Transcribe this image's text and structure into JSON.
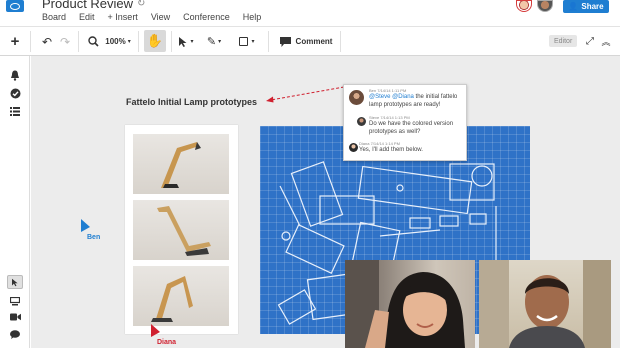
{
  "app": {
    "board_title": "Product Review",
    "menu": [
      "Board",
      "Edit",
      "+ Insert",
      "View",
      "Conference",
      "Help"
    ],
    "share_label": "Share"
  },
  "toolbar": {
    "zoom_value": "100%",
    "comment_label": "Comment",
    "mode_badge": "Editor"
  },
  "canvas": {
    "title": "Fattelo Initial Lamp prototypes"
  },
  "cursors": {
    "ben": {
      "label": "Ben",
      "color": "#1f7ed1"
    },
    "diana": {
      "label": "Diana",
      "color": "#d0202f"
    }
  },
  "comments": [
    {
      "meta": "Ben 7/14/14 1:11 PM",
      "mention_1": "@Steve",
      "mention_2": "@Diana",
      "text": " the initial fattelo lamp prototypes are ready!"
    },
    {
      "meta": "Steve 7/14/14 1:13 PM",
      "text": "Do we have the colored version prototypes as well?"
    },
    {
      "meta": "Diana 7/14/14 1:14 PM",
      "text": "Yes, I'll add them below."
    }
  ],
  "colors": {
    "accent": "#1f7ed1",
    "blueprint": "#2f72c7",
    "annotation_arrow": "#d0202f"
  },
  "icons": {
    "sidebar": [
      "bell-icon",
      "check-circle-icon",
      "list-icon",
      "pointer-icon",
      "presentation-icon",
      "video-icon",
      "chat-icon"
    ]
  }
}
